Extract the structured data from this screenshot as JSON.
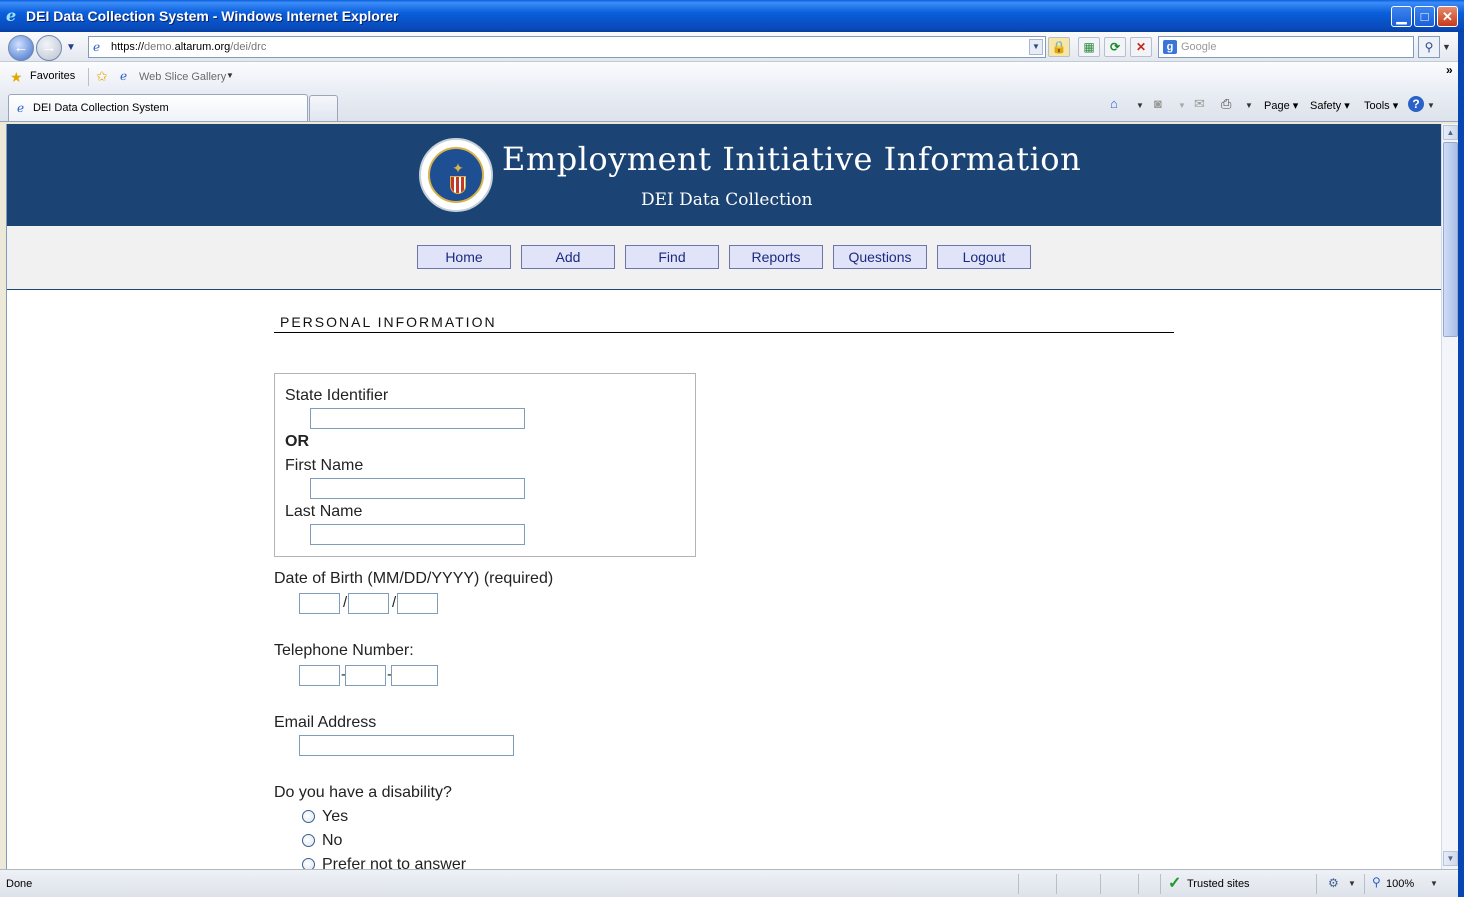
{
  "window": {
    "title": "DEI Data Collection System - Windows Internet Explorer",
    "min_label": "▁",
    "max_label": "□",
    "close_label": "✕"
  },
  "address": {
    "url_prefix": "https://",
    "url_host_pre": "demo.",
    "url_host": "altarum.org",
    "url_path": "/dei/drc"
  },
  "search": {
    "placeholder": "Google",
    "engine_badge": "g"
  },
  "favorites": {
    "label": "Favorites",
    "web_slice": "Web Slice Gallery"
  },
  "tabs": [
    {
      "label": "DEI Data Collection System"
    }
  ],
  "commands": {
    "page": "Page",
    "safety": "Safety",
    "tools": "Tools"
  },
  "banner": {
    "title": "Employment Initiative Information",
    "subtitle": "DEI Data Collection"
  },
  "nav": [
    {
      "label": "Home"
    },
    {
      "label": "Add"
    },
    {
      "label": "Find"
    },
    {
      "label": "Reports"
    },
    {
      "label": "Questions"
    },
    {
      "label": "Logout"
    }
  ],
  "form": {
    "section_heading": "PERSONAL INFORMATION",
    "state_identifier_label": "State Identifier",
    "or_label": "OR",
    "first_name_label": "First Name",
    "last_name_label": "Last Name",
    "dob_label": "Date of Birth (MM/DD/YYYY) (required)",
    "dob_sep": "/",
    "phone_label": "Telephone Number:",
    "phone_sep": "-",
    "email_label": "Email Address",
    "disability_question": "Do you have a disability?",
    "disability_options": [
      "Yes",
      "No",
      "Prefer not to answer"
    ]
  },
  "status": {
    "text": "Done",
    "zone": "Trusted sites",
    "zoom": "100%"
  }
}
